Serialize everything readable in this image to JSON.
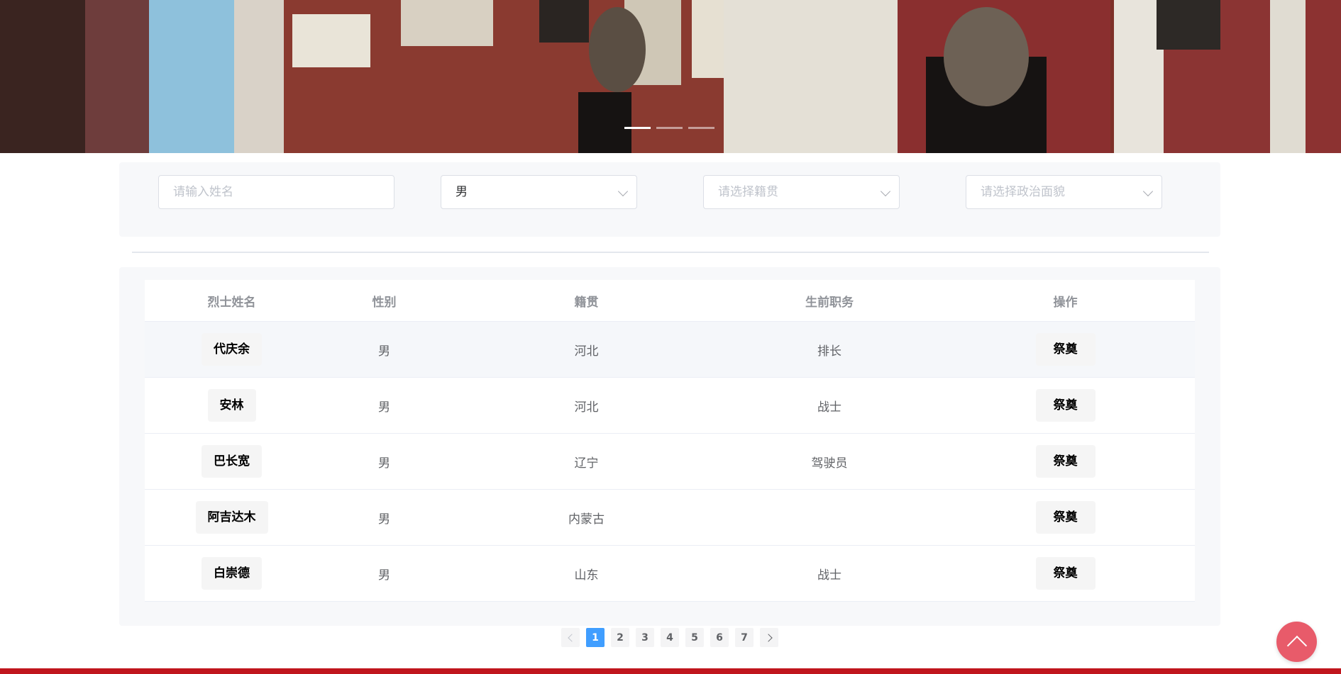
{
  "banner": {
    "slides": [
      "slide-1",
      "slide-2",
      "slide-3"
    ],
    "active_index": 0
  },
  "filters": {
    "name_placeholder": "请输入姓名",
    "gender_value": "男",
    "origin_placeholder": "请选择籍贯",
    "politics_placeholder": "请选择政治面貌"
  },
  "table": {
    "headers": [
      "烈士姓名",
      "性别",
      "籍贯",
      "生前职务",
      "操作"
    ],
    "rows": [
      {
        "name": "代庆余",
        "gender": "男",
        "origin": "河北",
        "position": "排长",
        "action": "祭奠"
      },
      {
        "name": "安林",
        "gender": "男",
        "origin": "河北",
        "position": "战士",
        "action": "祭奠"
      },
      {
        "name": "巴长宽",
        "gender": "男",
        "origin": "辽宁",
        "position": "驾驶员",
        "action": "祭奠"
      },
      {
        "name": "阿吉达木",
        "gender": "男",
        "origin": "内蒙古",
        "position": "",
        "action": "祭奠"
      },
      {
        "name": "白崇德",
        "gender": "男",
        "origin": "山东",
        "position": "战士",
        "action": "祭奠"
      }
    ]
  },
  "pagination": {
    "pages": [
      "1",
      "2",
      "3",
      "4",
      "5",
      "6",
      "7"
    ],
    "current": "1"
  },
  "icons": {
    "prev": "chevron-left-icon",
    "next": "chevron-right-icon",
    "back_to_top": "chevron-up-icon",
    "select_arrow": "chevron-down-icon"
  },
  "colors": {
    "accent": "#409eff",
    "footer": "#c0161d",
    "back_to_top": "#e85b6a"
  }
}
